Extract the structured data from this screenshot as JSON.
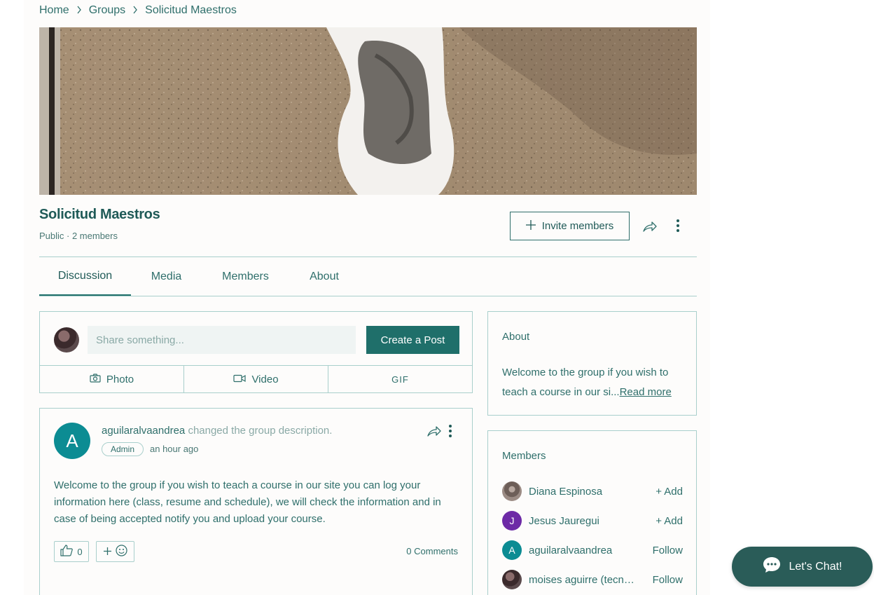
{
  "breadcrumb": {
    "items": [
      "Home",
      "Groups",
      "Solicitud Maestros"
    ]
  },
  "group": {
    "title": "Solicitud Maestros",
    "meta": "Public · 2 members",
    "invite_label": "Invite members"
  },
  "tabs": [
    "Discussion",
    "Media",
    "Members",
    "About"
  ],
  "active_tab": "Discussion",
  "composer": {
    "placeholder": "Share something...",
    "create_label": "Create a Post",
    "actions": [
      "Photo",
      "Video",
      "GIF"
    ]
  },
  "post": {
    "avatar_letter": "A",
    "author": "aguilaralvaandrea",
    "action": "changed the group description.",
    "badge": "Admin",
    "time": "an hour ago",
    "body": "Welcome to the group if you wish to teach a course in our site you can log your information here (class, resume and schedule), we will check the information and in case of being accepted notify you and upload your course.",
    "likes": "0",
    "comments": "0 Comments"
  },
  "about": {
    "title": "About",
    "text": "Welcome to the group if you wish to teach a course in our si...",
    "read_more": "Read more"
  },
  "members": {
    "title": "Members",
    "list": [
      {
        "name": "Diana Espinosa",
        "action": "+ Add",
        "avatar": ""
      },
      {
        "name": "Jesus Jauregui",
        "action": "+ Add",
        "avatar": "J"
      },
      {
        "name": "aguilaralvaandrea",
        "action": "Follow",
        "avatar": "A"
      },
      {
        "name": "moises aguirre (tecn…",
        "action": "Follow",
        "avatar": ""
      }
    ]
  },
  "chat": {
    "label": "Let's Chat!"
  },
  "colors": {
    "primary": "#1f6f6a",
    "text": "#2f6f6b",
    "border": "#a9cfcc",
    "chat_bg": "#2a5c58",
    "avatar_teal": "#0c8c93",
    "avatar_purple": "#6d2aa6"
  }
}
